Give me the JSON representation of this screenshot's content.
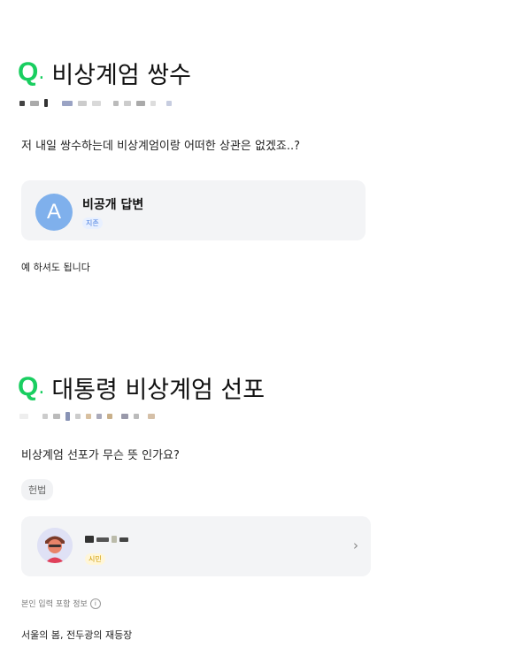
{
  "questions": [
    {
      "q_mark": "Q",
      "title": "비상계엄 쌍수",
      "body": "저 내일 쌍수하는데 비상계엄이랑 어떠한 상관은 없겠죠..?",
      "answer": {
        "avatar_letter": "A",
        "author": "비공개 답변",
        "badge": "지존",
        "text": "예 하셔도 됩니다"
      }
    },
    {
      "q_mark": "Q",
      "title": "대통령 비상계엄 선포",
      "body": "비상계엄 선포가 무슨 뜻 인가요?",
      "tag": "헌법",
      "answer": {
        "badge": "시민",
        "chevron": "›",
        "info_label": "본인 입력 포함 정보",
        "info_icon": "i",
        "text": "서울의 봄, 전두광의 재등장"
      }
    }
  ],
  "colors": {
    "accent_green": "#19ce60",
    "card_bg": "#f3f4f6",
    "avatar_blue": "#7fb0ec"
  },
  "icons": [
    "q-mark-icon",
    "avatar-icon",
    "chevron-right-icon",
    "info-icon"
  ]
}
